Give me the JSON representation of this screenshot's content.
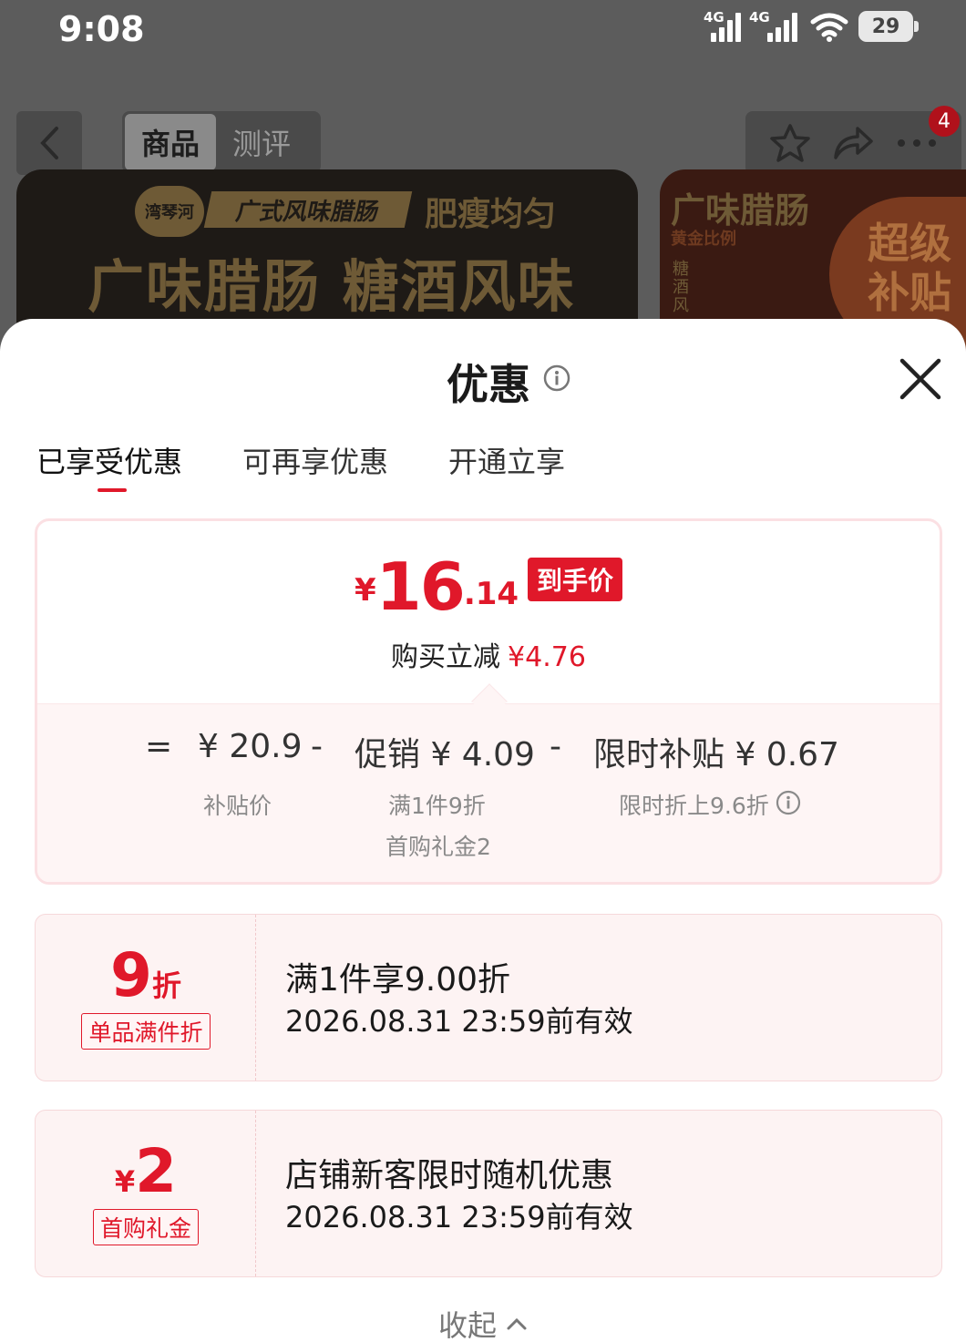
{
  "status_bar": {
    "time": "9:08",
    "signal_label": "4G",
    "battery": "29"
  },
  "nav": {
    "tabs": [
      {
        "label": "商品"
      },
      {
        "label": "测评"
      }
    ],
    "badge_count": "4"
  },
  "banner": {
    "logo": "湾琴河",
    "tag": "广式风味腊肠",
    "sub": "肥瘦均匀",
    "title": "广味腊肠 糖酒风味",
    "side_title": "广味腊肠",
    "side_sub": "黄金比例",
    "side_col": "糖酒风",
    "side_big": "超级补贴"
  },
  "sheet": {
    "title": "优惠",
    "tabs": [
      {
        "label": "已享受优惠"
      },
      {
        "label": "可再享优惠"
      },
      {
        "label": "开通立享"
      }
    ],
    "summary": {
      "price_symbol": "¥",
      "price_int": "16",
      "price_dec": ".14",
      "price_tag": "到手价",
      "reduce_label": "购买立减",
      "reduce_value": "¥4.76",
      "breakdown": {
        "eq": "=",
        "base_value": "¥ 20.9",
        "base_label": "补贴价",
        "minus": "-",
        "promo_label_value": "促销 ¥ 4.09",
        "promo_sub1": "满1件9折",
        "promo_sub2": "首购礼金2",
        "subsidy_label_value": "限时补贴 ¥ 0.67",
        "subsidy_sub": "限时折上9.6折"
      }
    },
    "coupons": [
      {
        "value": "9",
        "unit": "折",
        "unit_before": "",
        "label": "单品满件折",
        "title": "满1件享9.00折",
        "date": "2026.08.31 23:59前有效"
      },
      {
        "value": "2",
        "unit": "",
        "unit_before": "¥",
        "label": "首购礼金",
        "title": "店铺新客限时随机优惠",
        "date": "2026.08.31 23:59前有效"
      }
    ],
    "collapse_label": "收起"
  },
  "colors": {
    "accent": "#e0182a",
    "card_bg": "#fdf3f3",
    "overlay": "#5c5c5c"
  }
}
